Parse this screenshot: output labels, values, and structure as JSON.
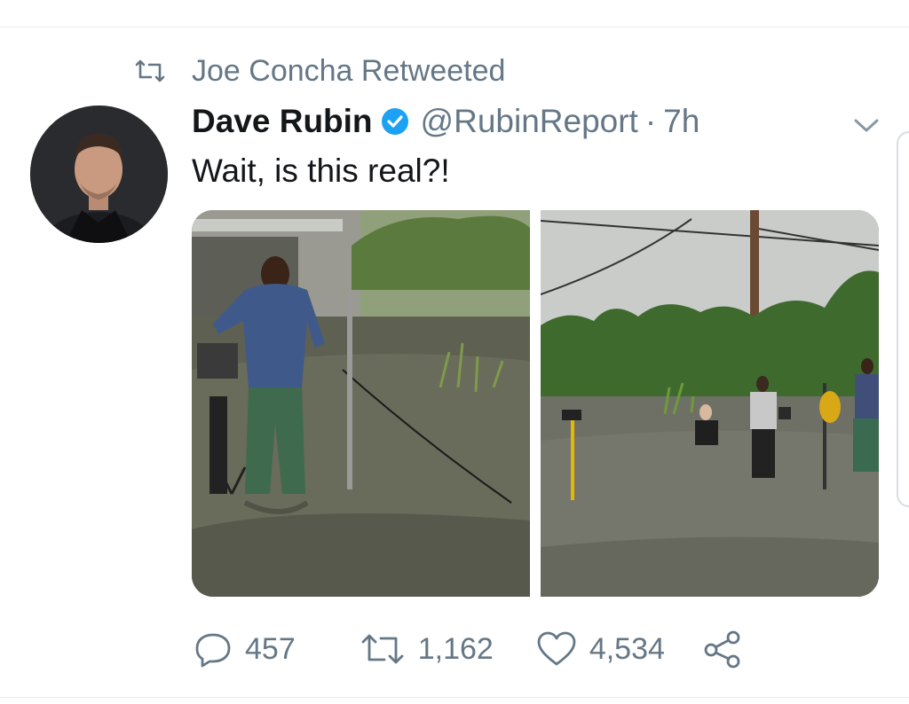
{
  "retweet": {
    "text": "Joe Concha Retweeted",
    "icon": "retweet-icon"
  },
  "tweet": {
    "author_name": "Dave Rubin",
    "verified": true,
    "handle": "@RubinReport",
    "separator": "·",
    "time": "7h",
    "text": "Wait, is this real?!"
  },
  "media": {
    "count": 2,
    "items": [
      {
        "type": "photo",
        "description_icon": "photo-icon"
      },
      {
        "type": "photo",
        "description_icon": "photo-icon"
      }
    ]
  },
  "actions": {
    "replies": "457",
    "retweets": "1,162",
    "likes": "4,534"
  },
  "colors": {
    "accent": "#1da1f2",
    "muted": "#657786",
    "text": "#14171a",
    "divider": "#e6ecf0"
  }
}
